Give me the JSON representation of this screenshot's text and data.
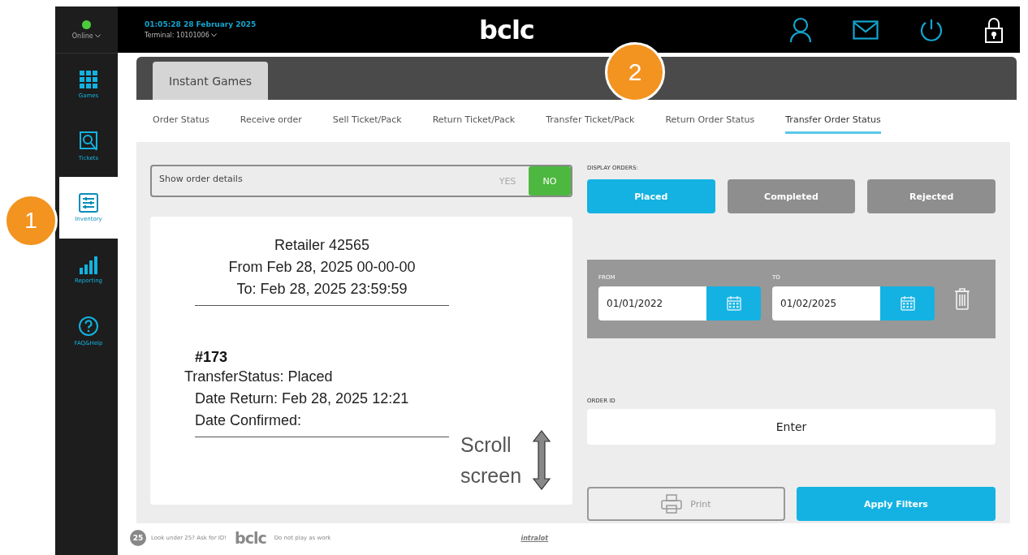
{
  "status": {
    "label": "Online",
    "online": true
  },
  "header": {
    "datetime": "01:05:28  28 February 2025",
    "terminal": "Terminal: 10101006",
    "logo": "bclc"
  },
  "sidebar": {
    "items": [
      {
        "kind": "games",
        "label": "Games",
        "selected": false
      },
      {
        "kind": "tickets",
        "label": "Tickets",
        "selected": false
      },
      {
        "kind": "inventory",
        "label": "Inventory",
        "selected": true
      },
      {
        "kind": "reporting",
        "label": "Reporting",
        "selected": false
      },
      {
        "kind": "help",
        "label": "FAQ&Help",
        "selected": false
      }
    ]
  },
  "tabs": [
    {
      "label": "Instant Games",
      "selected": true
    }
  ],
  "subtabs": [
    {
      "label": "Order Status",
      "selected": false
    },
    {
      "label": "Receive order",
      "selected": false
    },
    {
      "label": "Sell Ticket/Pack",
      "selected": false
    },
    {
      "label": "Return Ticket/Pack",
      "selected": false
    },
    {
      "label": "Transfer Ticket/Pack",
      "selected": false
    },
    {
      "label": "Return Order Status",
      "selected": false
    },
    {
      "label": "Transfer Order Status",
      "selected": true
    }
  ],
  "toggle": {
    "label": "Show order details",
    "options": [
      {
        "label": "YES",
        "selected": false
      },
      {
        "label": "NO",
        "selected": true
      }
    ]
  },
  "receipt": {
    "header": [
      "Retailer  42565",
      "From Feb 28, 2025 00-00-00",
      "To: Feb 28, 2025 23:59:59"
    ],
    "order_number": "#173",
    "lines": [
      "TransferStatus: Placed",
      "Date Return: Feb 28, 2025  12:21",
      "Date Confirmed:"
    ]
  },
  "display_orders": {
    "label": "DISPLAY ORDERS:",
    "options": [
      {
        "label": "Placed",
        "selected": true
      },
      {
        "label": "Completed",
        "selected": false
      },
      {
        "label": "Rejected",
        "selected": false
      }
    ]
  },
  "date_range": {
    "from_label": "FROM",
    "from": "01/01/2022",
    "to_label": "TO",
    "to": "01/02/2025"
  },
  "order_id": {
    "label": "ORDER ID",
    "placeholder": "Enter"
  },
  "actions": {
    "print": {
      "label": "Print",
      "disabled": true
    },
    "apply": {
      "label": "Apply Filters",
      "disabled": false
    }
  },
  "footer": {
    "age_badge": "25",
    "age_text": "Look under 25? Ask for ID!",
    "logo": "bclc",
    "notice": "Do not play as work",
    "partner": "intralot"
  },
  "annotations": {
    "markers": [
      "1",
      "2"
    ],
    "scroll_note": "Scroll screen"
  }
}
